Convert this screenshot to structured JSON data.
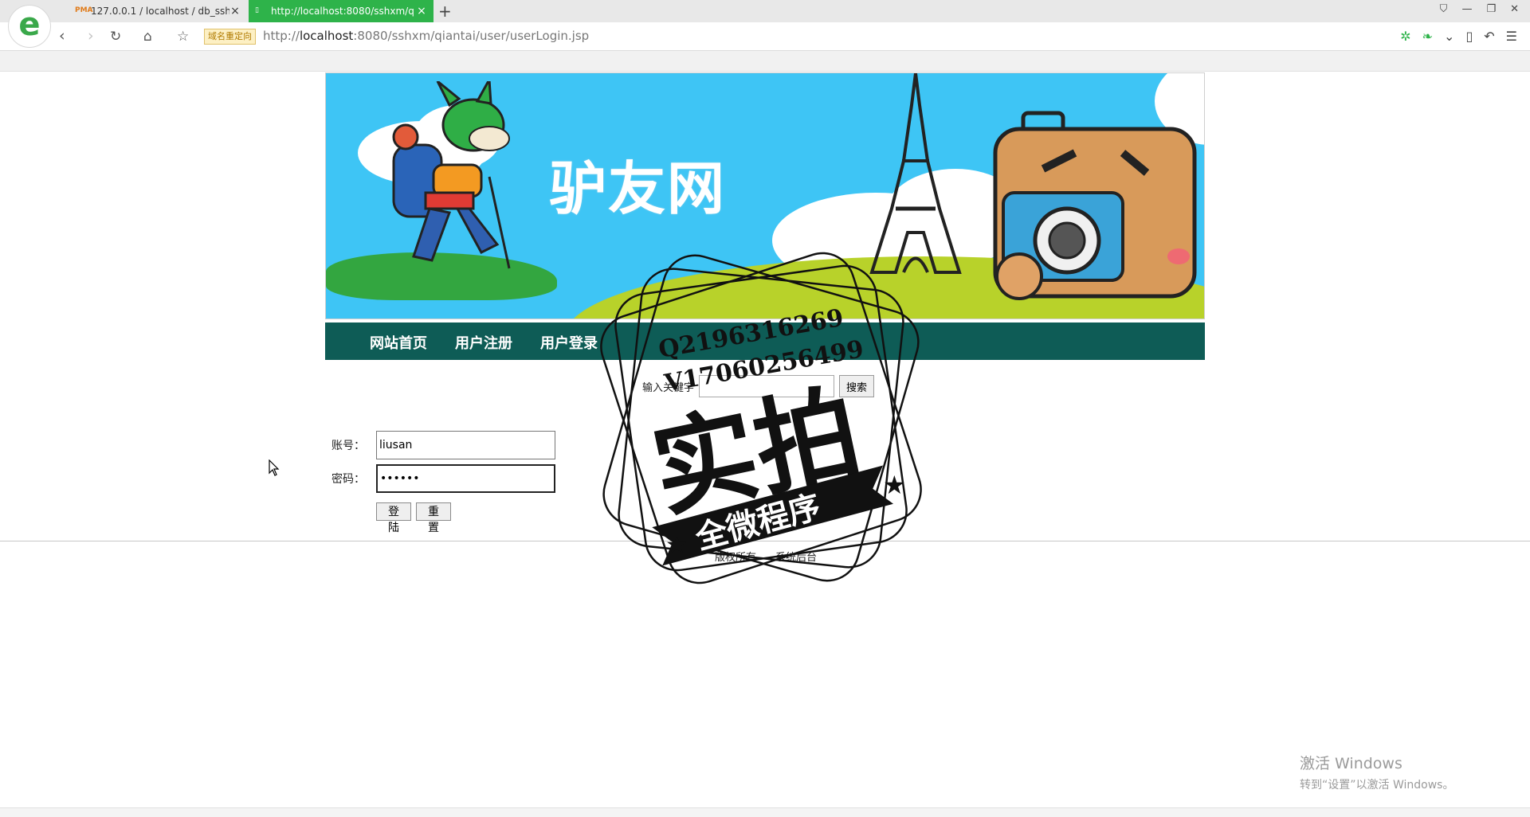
{
  "browser": {
    "tabs": [
      {
        "title": "127.0.0.1 / localhost / db_ssh",
        "favicon": "PMA"
      },
      {
        "title": "http://localhost:8080/sshxm/q",
        "active": true
      }
    ],
    "redirect_badge": "域名重定向",
    "url_prefix": "http://",
    "url_host": "localhost",
    "url_rest": ":8080/sshxm/qiantai/user/userLogin.jsp"
  },
  "banner": {
    "title": "驴友网"
  },
  "nav": {
    "items": [
      "网站首页",
      "用户注册",
      "用户登录"
    ]
  },
  "search": {
    "label": "输入关键字",
    "button": "搜索"
  },
  "login": {
    "account_label": "账号：",
    "account_value": "liusan",
    "password_label": "密码：",
    "password_value": "••••••",
    "login_button": "登陆",
    "reset_button": "重置"
  },
  "footer": {
    "copyright": "版权所有",
    "admin_link": "系统后台"
  },
  "watermark": {
    "line1": "Q2196316269",
    "line2": "V17060256499",
    "main": "实拍",
    "ribbon": "全微程序"
  },
  "windows_activation": {
    "title": "激活 Windows",
    "subtitle": "转到“设置”以激活 Windows。"
  },
  "colors": {
    "accent_green": "#2eb34a",
    "menu_bg": "#0e5c56",
    "banner_sky": "#3ec5f5"
  }
}
